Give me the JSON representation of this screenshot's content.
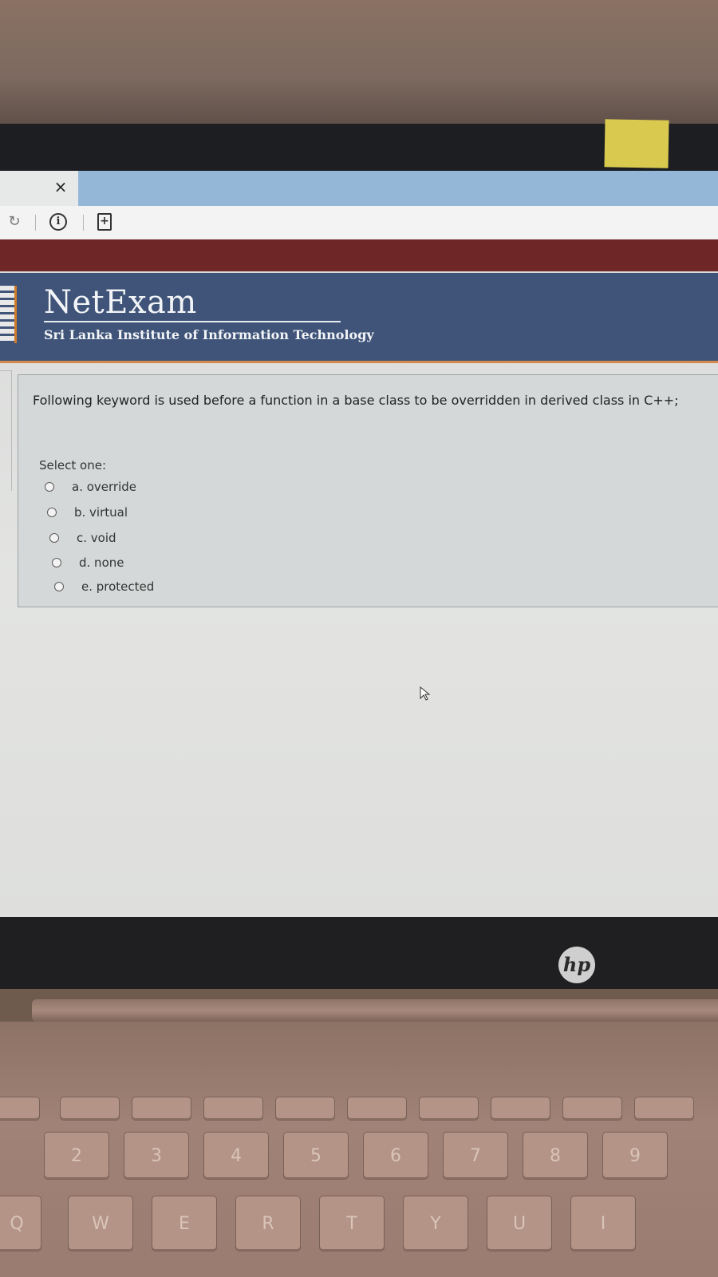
{
  "browser": {
    "tab_close_glyph": "×",
    "reload_glyph": "↻",
    "info_glyph": "i",
    "page_glyph": "+"
  },
  "header": {
    "brand": "NetExam",
    "institute": "Sri Lanka Institute of Information Technology"
  },
  "question": {
    "text": "Following keyword is used before a function in a base class to be overridden in derived class in C++;",
    "prompt": "Select one:",
    "options": [
      {
        "label": "a. override",
        "selected": false
      },
      {
        "label": "b. virtual",
        "selected": false
      },
      {
        "label": "c. void",
        "selected": false
      },
      {
        "label": "d. none",
        "selected": false
      },
      {
        "label": "e. protected",
        "selected": false
      }
    ]
  },
  "device": {
    "logo_text": "hp"
  },
  "keyboard": {
    "number_row": [
      "2",
      "3",
      "4",
      "5",
      "6",
      "7",
      "8",
      "9"
    ],
    "letter_row": [
      "Q",
      "W",
      "E",
      "R",
      "T",
      "Y",
      "U",
      "I"
    ]
  },
  "colors": {
    "header_blue": "#3f5478",
    "maroon": "#6e2626",
    "accent_orange": "#d48a4a"
  }
}
